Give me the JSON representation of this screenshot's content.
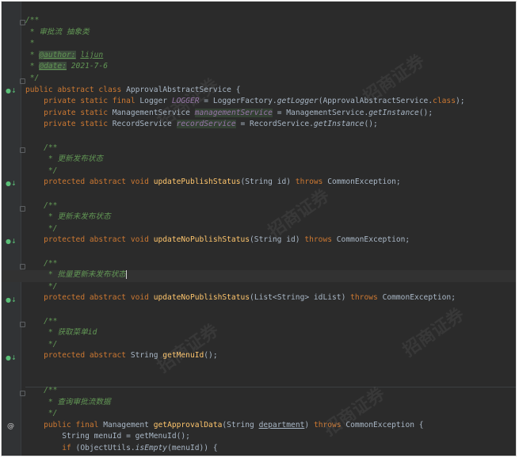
{
  "code": {
    "doc_title": "审批流 抽象类",
    "author_tag": "@author:",
    "author_value": "lijun",
    "date_tag": "@date:",
    "date_value": "2021-7-6",
    "class_decl": "ApprovalAbstractService",
    "logger_field": "LOGGER",
    "logger_factory": "LoggerFactory",
    "logger_call": "getLogger",
    "logger_arg": "ApprovalAbstractService",
    "mgmt_type": "ManagementService",
    "mgmt_field": "managementService",
    "get_instance": "getInstance",
    "record_type": "RecordService",
    "record_field": "recordService",
    "comment_update_publish": "更新发布状态",
    "method_update_publish": "updatePublishStatus",
    "comment_update_no_publish": "更新未发布状态",
    "method_update_no_publish": "updateNoPublishStatus",
    "comment_batch": "批量更新未发布状态",
    "list_type": "List<String>",
    "list_param": "idList",
    "comment_menu": "获取菜单id",
    "method_menu": "getMenuId",
    "comment_query": "查询审批流数据",
    "mgmt_return": "Management",
    "method_approval": "getApprovalData",
    "param_department": "department",
    "exception": "CommonException",
    "local_menu_id": "menuId",
    "object_utils": "ObjectUtils",
    "is_empty": "isEmpty"
  },
  "watermarks": [
    "招商证券",
    "www.cmschina.com"
  ],
  "colors": {
    "background": "#2b2b2b",
    "keyword": "#cc7832",
    "comment": "#629755",
    "method": "#ffc66d",
    "field": "#9876aa",
    "text": "#a9b7c6"
  }
}
